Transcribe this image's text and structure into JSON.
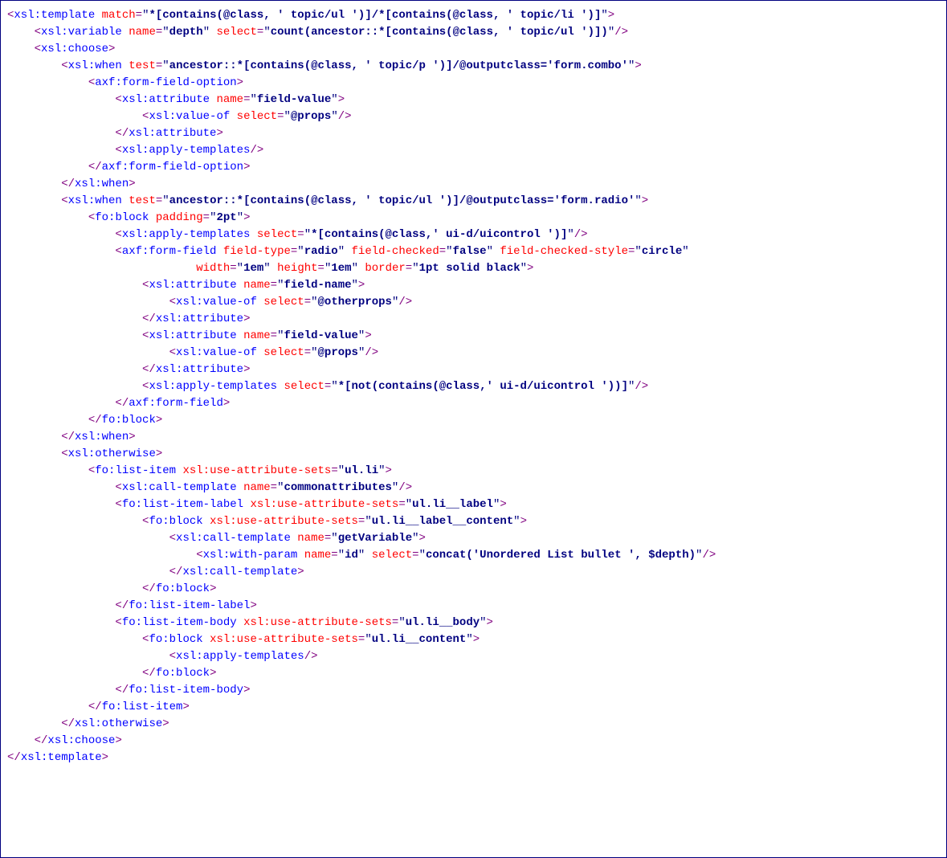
{
  "l1": {
    "match": "*[contains(@class, ' topic/ul ')]/*[contains(@class, ' topic/li ')]"
  },
  "l2": {
    "name": "depth",
    "select": "count(ancestor::*[contains(@class, ' topic/ul ')])"
  },
  "l4": {
    "test": "ancestor::*[contains(@class, ' topic/p ')]/@outputclass='form.combo'"
  },
  "l6": {
    "name": "field-value"
  },
  "l7": {
    "select": "@props"
  },
  "l12": {
    "test": "ancestor::*[contains(@class, ' topic/ul ')]/@outputclass='form.radio'"
  },
  "l13": {
    "padding": "2pt"
  },
  "l14": {
    "select": "*[contains(@class,' ui-d/uicontrol ')]"
  },
  "l15": {
    "fieldType": "radio",
    "fieldChecked": "false",
    "fieldCheckedStyle": "circle"
  },
  "l16": {
    "width": "1em",
    "height": "1em",
    "border": "1pt solid black"
  },
  "l17": {
    "name": "field-name"
  },
  "l18": {
    "select": "@otherprops"
  },
  "l20": {
    "name": "field-value"
  },
  "l21": {
    "select": "@props"
  },
  "l23": {
    "select": "*[not(contains(@class,' ui-d/uicontrol '))]"
  },
  "l28": {
    "uas": "ul.li"
  },
  "l29": {
    "name": "commonattributes"
  },
  "l30": {
    "uas": "ul.li__label"
  },
  "l31": {
    "uas": "ul.li__label__content"
  },
  "l32": {
    "name": "getVariable"
  },
  "l33": {
    "name": "id",
    "select": "concat('Unordered List bullet ', $depth)"
  },
  "l37": {
    "uas": "ul.li__body"
  },
  "l38": {
    "uas": "ul.li__content"
  }
}
